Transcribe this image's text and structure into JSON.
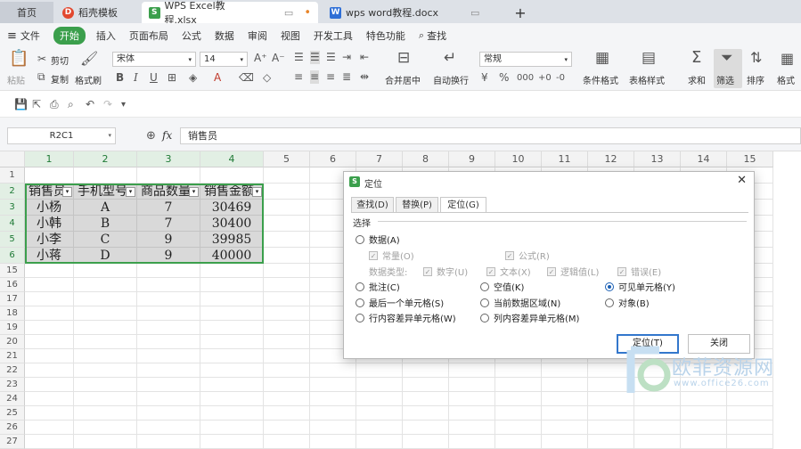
{
  "tabs": [
    {
      "label": "首页"
    },
    {
      "label": "稻壳模板"
    },
    {
      "label": "WPS Excel教程.xlsx"
    },
    {
      "label": "wps word教程.docx"
    }
  ],
  "menu": [
    "文件",
    "开始",
    "插入",
    "页面布局",
    "公式",
    "数据",
    "审阅",
    "视图",
    "开发工具",
    "特色功能",
    "查找"
  ],
  "ribbon": {
    "paste": "粘贴",
    "cut": "剪切",
    "copy": "复制",
    "format_painter": "格式刷",
    "font_name": "宋体",
    "font_size": "14",
    "merge": "合并居中",
    "wrap": "自动换行",
    "number_format": "常规",
    "cond_format": "条件格式",
    "table_style": "表格样式",
    "sum": "求和",
    "filter": "筛选",
    "sort": "排序",
    "format": "格式"
  },
  "formula_bar": {
    "name_box": "R2C1",
    "fx": "fx",
    "value": "销售员"
  },
  "columns": [
    "1",
    "2",
    "3",
    "4",
    "5",
    "6",
    "7",
    "8",
    "9",
    "10",
    "11",
    "12",
    "13",
    "14",
    "15"
  ],
  "rows": [
    "1",
    "2",
    "3",
    "4",
    "5",
    "6",
    "15",
    "16",
    "17",
    "18",
    "19",
    "20",
    "21",
    "22",
    "23",
    "24",
    "25",
    "26",
    "27"
  ],
  "table": {
    "headers": [
      "销售员",
      "手机型号",
      "商品数量",
      "销售金额"
    ],
    "data": [
      [
        "小杨",
        "A",
        "7",
        "30469"
      ],
      [
        "小韩",
        "B",
        "7",
        "30400"
      ],
      [
        "小李",
        "C",
        "9",
        "39985"
      ],
      [
        "小蒋",
        "D",
        "9",
        "40000"
      ]
    ]
  },
  "dialog": {
    "title": "定位",
    "tabs": [
      "查找(D)",
      "替换(P)",
      "定位(G)"
    ],
    "section": "选择",
    "data_option": "数据(A)",
    "constants": "常量(O)",
    "formulas": "公式(R)",
    "data_types_label": "数据类型:",
    "types": [
      "数字(U)",
      "文本(X)",
      "逻辑值(L)",
      "错误(E)"
    ],
    "options": [
      "批注(C)",
      "空值(K)",
      "可见单元格(Y)",
      "最后一个单元格(S)",
      "当前数据区域(N)",
      "对象(B)",
      "行内容差异单元格(W)",
      "列内容差异单元格(M)"
    ],
    "ok": "定位(T)",
    "close": "关闭"
  },
  "watermark": {
    "brand": "欧菲资源网",
    "url": "www.office26.com"
  },
  "colors": {
    "accent_green": "#3b9f4c",
    "selection_blue": "#3377cc",
    "title_red": "#d84b2a"
  }
}
